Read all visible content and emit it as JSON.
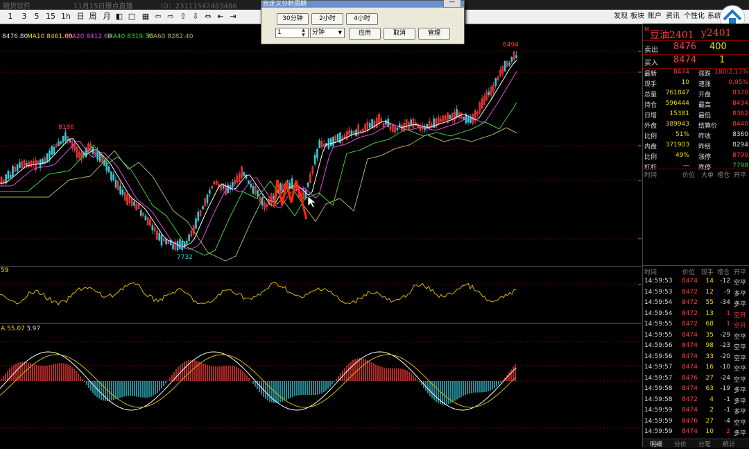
{
  "window": {
    "title": "期货软件",
    "watermark_date": "11月15日爆点直播",
    "watermark_id": "ID：23111542483486"
  },
  "toolbar": {
    "periods": [
      "1",
      "3",
      "5",
      "15",
      "1h",
      "日",
      "周",
      "月"
    ],
    "right_menu": [
      "发现",
      "板块",
      "账户",
      "资讯",
      "个性化",
      "系统"
    ]
  },
  "dialog": {
    "title": "自定义分析周期",
    "preset_30min": "30分钟",
    "preset_2h": "2小时",
    "preset_4h": "4小时",
    "count_value": "1",
    "unit_value": "分钟",
    "apply": "应用",
    "cancel": "取消",
    "manage": "管理"
  },
  "ma_legend": {
    "price": "8476.80",
    "ma10": "MA10 8461.60",
    "ma20": "MA20 8412.60",
    "ma40": "MA40 8319.50",
    "ma60": "MA60 8282.40"
  },
  "annotations": {
    "high_left": "8186",
    "low": "7732",
    "high_right": "8494"
  },
  "indicator2_label": "A 55.07",
  "indicator2_value": "3.97",
  "indicator1_label": "59",
  "colors": {
    "up": "#ff3b3b",
    "down": "#35c8d8",
    "ma10": "#ffffff",
    "ma20": "#e64ce6",
    "ma40": "#3fd03f",
    "ma60": "#b0b060",
    "grid": "#7a0000"
  },
  "quote": {
    "badge": "M",
    "name": "豆油2401",
    "code": "y2401",
    "sell_label": "卖出",
    "sell_price": "8476",
    "sell_vol": "400",
    "buy_label": "买入",
    "buy_price": "8474",
    "buy_vol": "1",
    "rows": [
      {
        "l1": "最新",
        "v1": "8474",
        "c1": "red",
        "l2": "涨跌",
        "v2": "180/2.17%",
        "c2": "red"
      },
      {
        "l1": "现手",
        "v1": "10",
        "c1": "yel",
        "l2": "速涨",
        "v2": "0.05%",
        "c2": "red"
      },
      {
        "l1": "总量",
        "v1": "761847",
        "c1": "yel",
        "l2": "开盘",
        "v2": "8370",
        "c2": "red"
      },
      {
        "l1": "持仓",
        "v1": "596444",
        "c1": "yel",
        "l2": "最高",
        "v2": "8494",
        "c2": "red"
      },
      {
        "l1": "日增",
        "v1": "15381",
        "c1": "yel",
        "l2": "最低",
        "v2": "8362",
        "c2": "red"
      },
      {
        "l1": "外盘",
        "v1": "389943",
        "c1": "yel",
        "l2": "结算价",
        "v2": "8440",
        "c2": "red"
      },
      {
        "l1": "比例",
        "v1": "51%",
        "c1": "yel",
        "l2": "昨收",
        "v2": "8360",
        "c2": "wht"
      },
      {
        "l1": "内盘",
        "v1": "371903",
        "c1": "yel",
        "l2": "昨结",
        "v2": "8294",
        "c2": "wht"
      },
      {
        "l1": "比例",
        "v1": "49%",
        "c1": "yel",
        "l2": "涨停",
        "v2": "8790",
        "c2": "red"
      },
      {
        "l1": "杠杆",
        "v1": "—",
        "c1": "yel",
        "l2": "跌停",
        "v2": "7798",
        "c2": "grn"
      }
    ],
    "header1": [
      "时间",
      "价位",
      "大单",
      "增仓",
      "开平"
    ],
    "header2": [
      "时间",
      "价位",
      "现手",
      "增仓",
      "开平"
    ],
    "ticks": [
      {
        "t": "14:59:53",
        "p": "8474",
        "v": "14",
        "d": "-12",
        "k": "空平"
      },
      {
        "t": "14:59:53",
        "p": "8472",
        "v": "12",
        "d": "-9",
        "k": "多平"
      },
      {
        "t": "14:59:54",
        "p": "8472",
        "v": "55",
        "d": "-34",
        "k": "多平"
      },
      {
        "t": "14:59:54",
        "p": "8472",
        "v": "13",
        "d": "1",
        "k": "空开"
      },
      {
        "t": "14:59:55",
        "p": "8472",
        "v": "68",
        "d": "1",
        "k": "空开"
      },
      {
        "t": "14:59:55",
        "p": "8474",
        "v": "35",
        "d": "-29",
        "k": "空平"
      },
      {
        "t": "14:59:56",
        "p": "8474",
        "v": "98",
        "d": "-23",
        "k": "空平"
      },
      {
        "t": "14:59:56",
        "p": "8474",
        "v": "33",
        "d": "-20",
        "k": "空平"
      },
      {
        "t": "14:59:57",
        "p": "8474",
        "v": "16",
        "d": "-10",
        "k": "空平"
      },
      {
        "t": "14:59:57",
        "p": "8476",
        "v": "27",
        "d": "-24",
        "k": "空平"
      },
      {
        "t": "14:59:58",
        "p": "8474",
        "v": "63",
        "d": "-19",
        "k": "多平"
      },
      {
        "t": "14:59:58",
        "p": "8472",
        "v": "4",
        "d": "-1",
        "k": "多平"
      },
      {
        "t": "14:59:59",
        "p": "8474",
        "v": "2",
        "d": "-1",
        "k": "多平"
      },
      {
        "t": "14:59:59",
        "p": "8476",
        "v": "27",
        "d": "-4",
        "k": "空平"
      },
      {
        "t": "14:59:59",
        "p": "8474",
        "v": "10",
        "d": "2",
        "k": "多平"
      }
    ],
    "bottom_tabs": [
      "明细",
      "分价",
      "分笔",
      "统计"
    ]
  }
}
